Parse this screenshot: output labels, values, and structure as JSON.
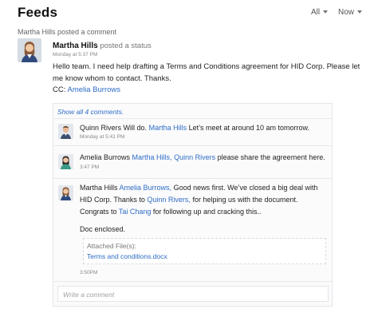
{
  "header": {
    "title": "Feeds",
    "filter_all": "All",
    "filter_now": "Now"
  },
  "activity_line": "Martha Hills posted a comment",
  "post": {
    "author": "Martha Hills",
    "action": "posted a status",
    "time": "Monday at 5:37 PM",
    "body": "Hello team. I need help drafting a Terms and Conditions agreement for HID Corp. Please let me know whom to contact. Thanks.",
    "cc_label": "CC:",
    "cc_user": "Amelia Burrows"
  },
  "comments": {
    "show_all": "Show all 4 comments.",
    "items": [
      {
        "author": "Quinn Rivers",
        "pre": "Will do.",
        "mention": "Martha Hills",
        "post": "Let’s meet at around 10 am tomorrow.",
        "time": "Monday at 5:41 PM"
      },
      {
        "author": "Amelia Burrows",
        "mention1": "Martha Hills,",
        "mention2": "Quinn Rivers",
        "post": "please share the agreement here.",
        "time": "3:47 PM"
      },
      {
        "author": "Martha Hills",
        "mention1": "Amelia Burrows,",
        "line1_post": "Good news first. We’ve closed a big deal with",
        "line2_pre": "HID Corp. Thanks to",
        "mention2": "Quinn Rivers,",
        "line2_post": "for helping us with the document.",
        "line3_pre": "Congrats to",
        "mention3": "Tai Chang",
        "line3_post": "for following up and cracking this..",
        "line4": "Doc enclosed.",
        "attach_label": "Attached File(s):",
        "attach_file": "Terms and conditions.docx",
        "time": "3:50PM"
      }
    ],
    "write_placeholder": "Write a comment"
  }
}
